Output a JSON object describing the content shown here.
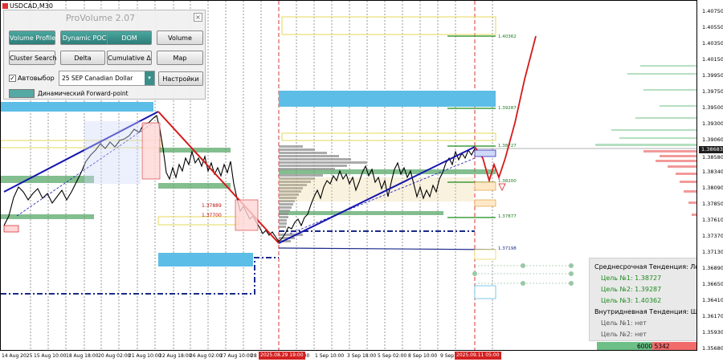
{
  "symbol": {
    "label": "USDCAD,M30"
  },
  "panel": {
    "title": "ProVolume 2.07",
    "close": "×",
    "buttons": [
      {
        "label": "Volume Profile",
        "style": "teal"
      },
      {
        "label": "Dynamic POC",
        "style": "teal"
      },
      {
        "label": "DOM",
        "style": "teal"
      },
      {
        "label": "Volume",
        "style": "grey"
      },
      {
        "label": "Cluster Search",
        "style": "grey"
      },
      {
        "label": "Delta",
        "style": "grey"
      },
      {
        "label": "Cumulative Δ",
        "style": "grey"
      },
      {
        "label": "Map",
        "style": "grey"
      }
    ],
    "auto_label": "Автовыбор",
    "auto_checked": "✓",
    "symbol_select": "25 SEP Canadian Dollar",
    "select_arrow": "▾",
    "settings_button": "Настройки",
    "dynamic_forward": "Динамический Forward-point"
  },
  "price_axis": {
    "ticks": [
      "1.40750",
      "1.40550",
      "1.40350",
      "1.40150",
      "1.39950",
      "1.39750",
      "1.39500",
      "1.39300",
      "1.39060",
      "1.38820",
      "1.38580",
      "1.38340",
      "1.38090",
      "1.37850",
      "1.37610",
      "1.37370",
      "1.37130",
      "1.36890",
      "1.36650",
      "1.36410",
      "1.36170",
      "1.35930",
      "1.35680"
    ],
    "current": "1.38683"
  },
  "time_axis": {
    "ticks": [
      "14 Aug 2025",
      "15 Aug 10:00",
      "18 Aug 18:00",
      "20 Aug 02:00",
      "21 Aug 10:00",
      "22 Aug 18:00",
      "26 Aug 02:00",
      "27 Aug 10:00",
      "28",
      "02:00",
      "1 Sep 10:00",
      "3 Sep 18:00",
      "5 Sep 02:00",
      "8 Sep 10:00",
      "9 Sep",
      "00"
    ],
    "marker_1": "2025.08.29 19:00",
    "marker_2": "2025.09.11 05:00"
  },
  "levels": {
    "l1": "1.40362",
    "l2": "1.39287",
    "l3": "1.38727",
    "l4": "1.38200",
    "l5": "1.37877",
    "l6": "1.37198",
    "box1": "1.37889",
    "box2": "1.37700"
  },
  "trend": {
    "mid_title": "Среднесрочная Тенденция: Лонг",
    "t1": "Цель №1: 1.38727",
    "t2": "Цель №2: 1.39287",
    "t3": "Цель №3: 1.40362",
    "intra_title": "Внутридневная Тенденция: Шорт",
    "i1": "Цель №1: нет",
    "i2": "Цель №2: нет"
  },
  "volume_bar": {
    "text": "6000  5342"
  },
  "colors": {
    "teal": "#3a8f8a",
    "trend_line": "#1515b0",
    "down_line": "#d41a1a",
    "zone_blue": "#5cbde6",
    "zone_green": "#5aa86a",
    "zone_yellow": "#e6d95a"
  }
}
